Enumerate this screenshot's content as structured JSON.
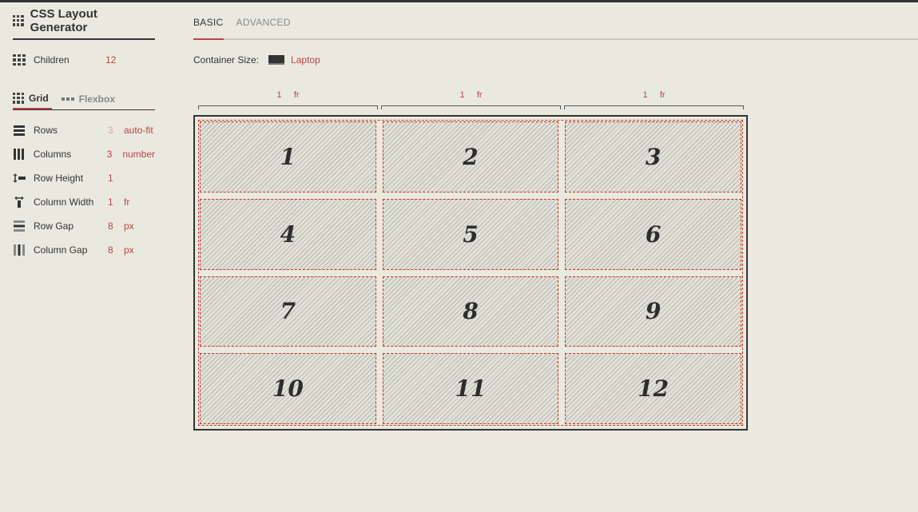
{
  "app": {
    "title": "CSS Layout Generator"
  },
  "children": {
    "label": "Children",
    "value": "12"
  },
  "mode_tabs": [
    {
      "label": "Grid",
      "active": true
    },
    {
      "label": "Flexbox",
      "active": false
    }
  ],
  "props": [
    {
      "icon": "rows-icon",
      "label": "Rows",
      "value": "3",
      "unit": "auto-fit"
    },
    {
      "icon": "columns-icon",
      "label": "Columns",
      "value": "3",
      "unit": "number"
    },
    {
      "icon": "row-height-icon",
      "label": "Row Height",
      "value": "1",
      "unit": ""
    },
    {
      "icon": "column-width-icon",
      "label": "Column Width",
      "value": "1",
      "unit": "fr"
    },
    {
      "icon": "row-gap-icon",
      "label": "Row Gap",
      "value": "8",
      "unit": "px"
    },
    {
      "icon": "column-gap-icon",
      "label": "Column Gap",
      "value": "8",
      "unit": "px"
    }
  ],
  "tabs": [
    {
      "label": "BASIC",
      "active": true
    },
    {
      "label": "ADVANCED",
      "active": false
    }
  ],
  "container_size": {
    "label": "Container Size:",
    "value": "Laptop"
  },
  "col_rulers": [
    "1     fr",
    "1     fr",
    "1     fr"
  ],
  "cells": [
    "1",
    "2",
    "3",
    "4",
    "5",
    "6",
    "7",
    "8",
    "9",
    "10",
    "11",
    "12"
  ],
  "colors": {
    "accent": "#b44646",
    "background": "#eae9df",
    "dark": "#333333"
  }
}
